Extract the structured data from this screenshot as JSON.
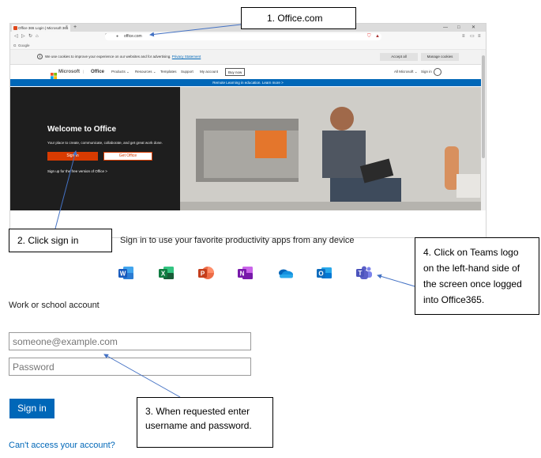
{
  "browser": {
    "tab_title": "Office 365 Login | Microsoft 365",
    "tab_close": "×",
    "new_tab": "+",
    "url": "office.com",
    "bookmark": "Google",
    "window_controls": [
      "—",
      "□",
      "✕"
    ]
  },
  "cookie_bar": {
    "text": "We use cookies to improve your experience on our websites and for advertising.",
    "privacy_link": "Privacy Statement",
    "accept": "Accept all",
    "manage": "Manage cookies"
  },
  "ms_nav": {
    "brand": "Microsoft",
    "product": "Office",
    "items": [
      "Products ⌄",
      "Resources ⌄",
      "Templates",
      "Support",
      "My account"
    ],
    "buy_now": "Buy now",
    "all_microsoft": "All Microsoft ⌄",
    "sign_in": "Sign in"
  },
  "banner": {
    "text": "Remote Learning in education. Learn more >"
  },
  "hero": {
    "title": "Welcome to Office",
    "subtitle": "Your place to create, communicate, collaborate, and get great work done.",
    "sign_in": "Sign in",
    "get_office": "Get Office",
    "free_version": "Sign up for the free version of Office >"
  },
  "apps": {
    "heading": "Sign in to use your favorite productivity apps from any device",
    "icons": [
      {
        "name": "word-icon",
        "letter": "W",
        "color": "#185abd"
      },
      {
        "name": "excel-icon",
        "letter": "X",
        "color": "#107c41"
      },
      {
        "name": "powerpoint-icon",
        "letter": "P",
        "color": "#c43e1c"
      },
      {
        "name": "onenote-icon",
        "letter": "N",
        "color": "#7719aa"
      },
      {
        "name": "onedrive-icon",
        "letter": "",
        "color": "#0f78d4"
      },
      {
        "name": "outlook-icon",
        "letter": "O",
        "color": "#0f6cbd"
      },
      {
        "name": "teams-icon",
        "letter": "T",
        "color": "#5b5fc7"
      }
    ]
  },
  "login": {
    "section_title": "Work or school account",
    "email_placeholder": "someone@example.com",
    "password_placeholder": "Password",
    "submit": "Sign in",
    "cant_access": "Can't access your account?"
  },
  "callouts": {
    "step1": "1.    Office.com",
    "step2": "2. Click sign in",
    "step3": "3. When requested enter username and password.",
    "step4": "4. Click on Teams logo on the left-hand side of the screen once logged into Office365."
  },
  "colors": {
    "ms_blue": "#0067b8",
    "office_orange": "#d83b01",
    "arrow": "#4472c4"
  }
}
